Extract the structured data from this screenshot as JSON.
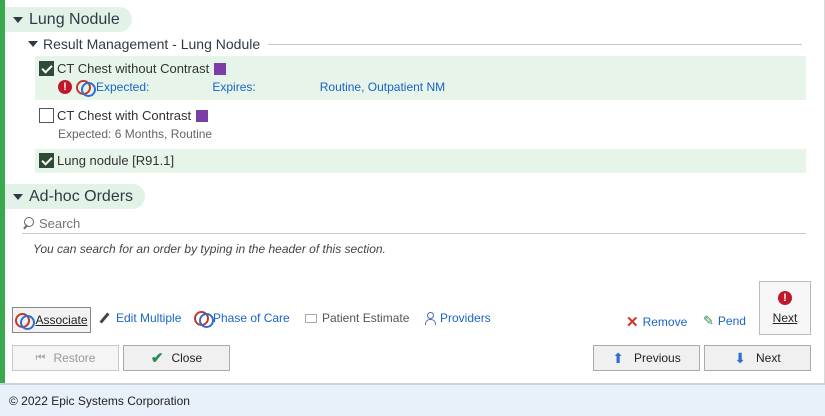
{
  "sections": {
    "lung_nodule": {
      "title": "Lung Nodule"
    },
    "result_management": {
      "title": "Result Management - Lung Nodule"
    },
    "adhoc": {
      "title": "Ad-hoc Orders"
    }
  },
  "orders": [
    {
      "label": "CT Chest without Contrast",
      "checked": true,
      "expected_label": "Expected:",
      "expires_label": "Expires:",
      "details": "Routine, Outpatient NM"
    },
    {
      "label": "CT Chest with Contrast",
      "checked": false,
      "expected_text": "Expected: 6 Months, Routine"
    },
    {
      "label": "Lung nodule [R91.1]",
      "checked": true
    }
  ],
  "search": {
    "placeholder": "Search",
    "hint": "You can search for an order by typing in the header of this section."
  },
  "toolbar": {
    "associate": "Associate",
    "edit_multiple": "Edit Multiple",
    "phase_of_care": "Phase of Care",
    "patient_estimate": "Patient Estimate",
    "providers": "Providers",
    "remove": "Remove",
    "pend": "Pend",
    "next_big": "Next"
  },
  "buttons": {
    "restore": "Restore",
    "close": "Close",
    "previous": "Previous",
    "next": "Next"
  },
  "footer": {
    "copyright": "© 2022 Epic Systems Corporation"
  },
  "colors": {
    "accent_green": "#3aa84d",
    "selected_row": "#e6f4ea",
    "link_blue": "#1a64c7",
    "order_marker": "#7a3fa6",
    "error_red": "#c0182a"
  }
}
